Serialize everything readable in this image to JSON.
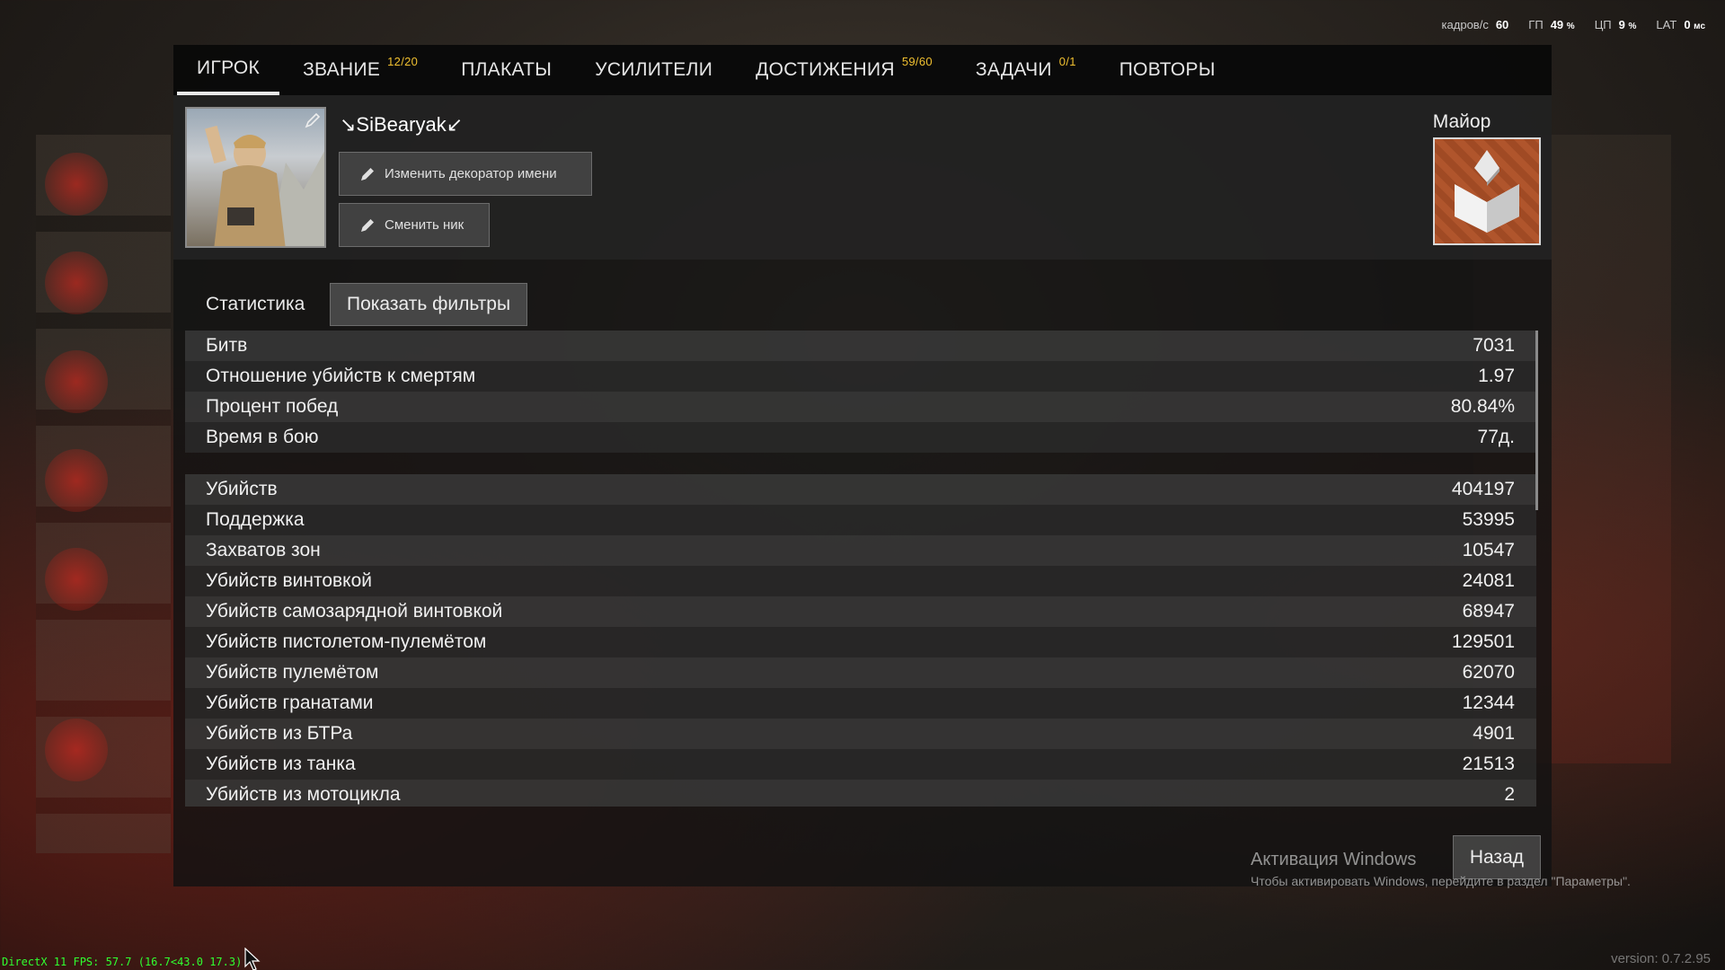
{
  "perf": {
    "fps_label": "кадров/с",
    "fps_value": "60",
    "gpu_label": "ГП",
    "gpu_value": "49",
    "gpu_unit": "%",
    "cpu_label": "ЦП",
    "cpu_value": "9",
    "cpu_unit": "%",
    "lat_label": "LAT",
    "lat_value": "0",
    "lat_unit": "мс"
  },
  "tabs": [
    {
      "label": "ИГРОК",
      "badge": "",
      "active": true
    },
    {
      "label": "ЗВАНИЕ",
      "badge": "12/20"
    },
    {
      "label": "ПЛАКАТЫ",
      "badge": ""
    },
    {
      "label": "УСИЛИТЕЛИ",
      "badge": ""
    },
    {
      "label": "ДОСТИЖЕНИЯ",
      "badge": "59/60"
    },
    {
      "label": "ЗАДАЧИ",
      "badge": "0/1"
    },
    {
      "label": "ПОВТОРЫ",
      "badge": ""
    }
  ],
  "profile": {
    "nickname": "↘SiBearyak↙",
    "change_decorator_label": "Изменить декоратор имени",
    "change_nick_label": "Сменить ник",
    "rank_title": "Майор"
  },
  "stats": {
    "heading": "Статистика",
    "filters_label": "Показать фильтры",
    "general": [
      {
        "label": "Битв",
        "value": "7031"
      },
      {
        "label": "Отношение убийств к смертям",
        "value": "1.97"
      },
      {
        "label": "Процент побед",
        "value": "80.84%"
      },
      {
        "label": "Время в бою",
        "value": "77д."
      }
    ],
    "combat": [
      {
        "label": "Убийств",
        "value": "404197"
      },
      {
        "label": "Поддержка",
        "value": "53995"
      },
      {
        "label": "Захватов зон",
        "value": "10547"
      },
      {
        "label": "Убийств винтовкой",
        "value": "24081"
      },
      {
        "label": "Убийств самозарядной винтовкой",
        "value": "68947"
      },
      {
        "label": "Убийств пистолетом-пулемётом",
        "value": "129501"
      },
      {
        "label": "Убийств пулемётом",
        "value": "62070"
      },
      {
        "label": "Убийств гранатами",
        "value": "12344"
      },
      {
        "label": "Убийств из БТРа",
        "value": "4901"
      },
      {
        "label": "Убийств из танка",
        "value": "21513"
      },
      {
        "label": "Убийств из мотоцикла",
        "value": "2"
      }
    ]
  },
  "back_label": "Назад",
  "windows_activation": {
    "title": "Активация Windows",
    "subtitle": "Чтобы активировать Windows, перейдите в раздел \"Параметры\"."
  },
  "debug_overlay": "DirectX 11 FPS: 57.7 (16.7<43.0 17.3)",
  "version": "version: 0.7.2.95",
  "colors": {
    "badge": "#f0c030",
    "debug_text": "#30ff30",
    "rank_badge": "#b0552c"
  }
}
